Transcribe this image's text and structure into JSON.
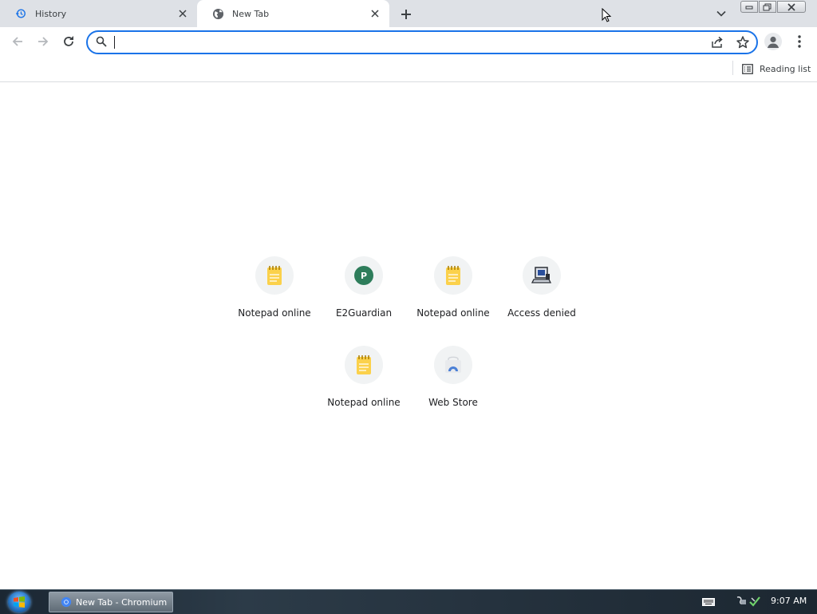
{
  "window": {
    "taskbar_title": "New Tab - Chromium"
  },
  "tabs": [
    {
      "title": "History",
      "icon": "history-icon",
      "active": false
    },
    {
      "title": "New Tab",
      "icon": "globe-icon",
      "active": true
    }
  ],
  "omnibox": {
    "value": "",
    "placeholder": ""
  },
  "bookmarks_bar": {
    "reading_list_label": "Reading list"
  },
  "shortcuts": [
    {
      "label": "Notepad online",
      "icon": "notepad-icon"
    },
    {
      "label": "E2Guardian",
      "icon": "letter-p-icon",
      "letter": "P"
    },
    {
      "label": "Notepad online",
      "icon": "notepad-icon"
    },
    {
      "label": "Access denied",
      "icon": "computer-icon"
    },
    {
      "label": "Notepad online",
      "icon": "notepad-icon"
    },
    {
      "label": "Web Store",
      "icon": "web-store-icon"
    }
  ],
  "taskbar": {
    "clock": "9:07 AM"
  },
  "colors": {
    "accent": "#1a73e8",
    "tabstrip": "#dee1e6",
    "e2guardian_badge": "#2e7d5b",
    "notepad_yellow": "#fbd14b"
  }
}
